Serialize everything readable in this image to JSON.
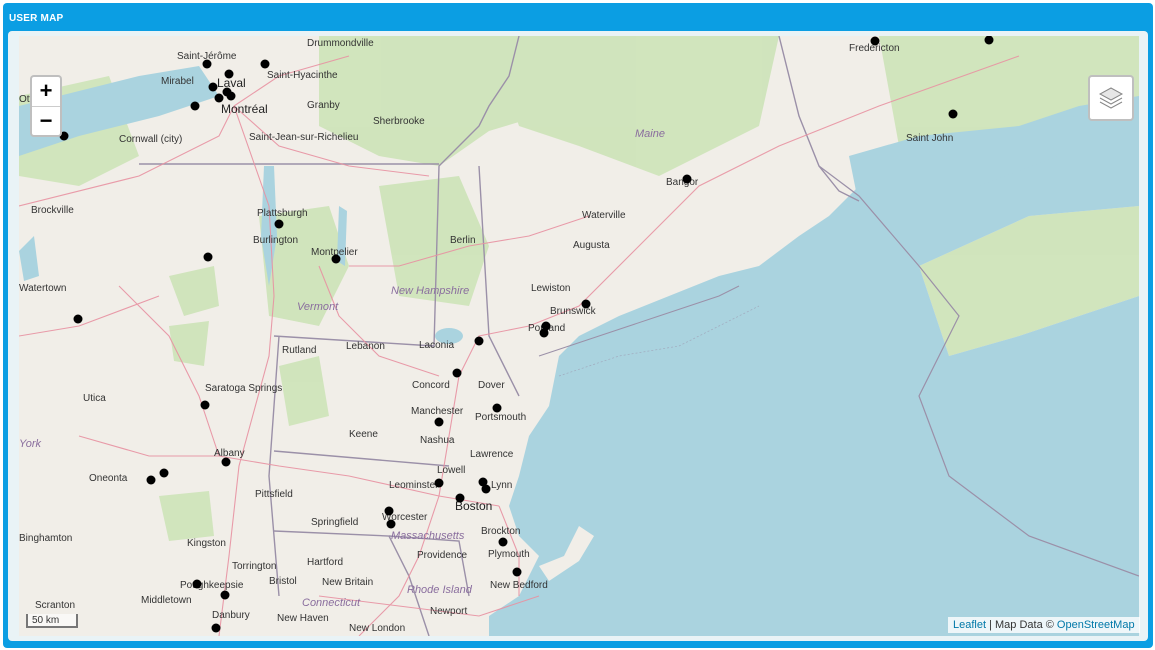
{
  "panel": {
    "title": "USER MAP"
  },
  "controls": {
    "zoom_in": "+",
    "zoom_out": "−",
    "layers_icon": "layers-icon"
  },
  "scale": {
    "label": "50 km"
  },
  "attribution": {
    "leaflet": "Leaflet",
    "sep": " | Map Data © ",
    "osm": "OpenStreetMap"
  },
  "regions": [
    "Maine",
    "Vermont",
    "New Hampshire",
    "Massachusetts",
    "Connecticut",
    "Rhode Island",
    "York"
  ],
  "cities": [
    "Drummondville",
    "Saint-Jérôme",
    "Mirabel",
    "Laval",
    "Montréal",
    "Saint-Hyacinthe",
    "Granby",
    "Sherbrooke",
    "Saint-Jean-sur-Richelieu",
    "Cornwall (city)",
    "Ottawa",
    "Brockville",
    "Plattsburgh",
    "Burlington",
    "Montpelier",
    "Berlin",
    "Fredericton",
    "Saint John",
    "Bangor",
    "Waterville",
    "Augusta",
    "Lewiston",
    "Brunswick",
    "Portland",
    "Watertown",
    "Rutland",
    "Lebanon",
    "Laconia",
    "Concord",
    "Dover",
    "Saratoga Springs",
    "Utica",
    "Manchester",
    "Portsmouth",
    "Keene",
    "Nashua",
    "Albany",
    "Lawrence",
    "Lowell",
    "Lynn",
    "Leominster",
    "Boston",
    "Oneonta",
    "Pittsfield",
    "Worcester",
    "Springfield",
    "Brockton",
    "Kingston",
    "Plymouth",
    "Providence",
    "Torrington",
    "Hartford",
    "Bristol",
    "New Britain",
    "New Bedford",
    "Poughkeepsie",
    "Middletown",
    "Scranton",
    "Danbury",
    "New Haven",
    "New London",
    "Newport",
    "Binghamton"
  ],
  "markers_count_note": "user-location markers shown as black dots"
}
